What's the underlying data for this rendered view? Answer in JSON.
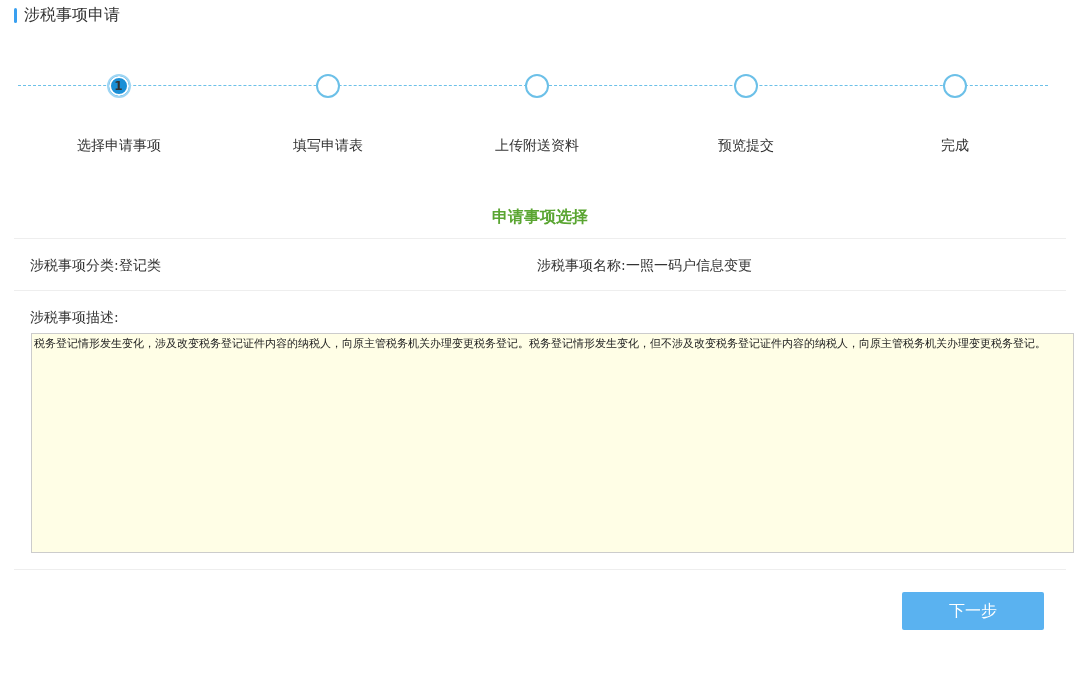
{
  "page_title": "涉税事项申请",
  "steps": [
    {
      "label": "选择申请事项",
      "number": "1",
      "selected": true
    },
    {
      "label": "填写申请表",
      "selected": false
    },
    {
      "label": "上传附送资料",
      "selected": false
    },
    {
      "label": "预览提交",
      "selected": false
    },
    {
      "label": "完成",
      "selected": false
    }
  ],
  "section_title": "申请事项选择",
  "fields": [
    {
      "label": "涉税事项分类:",
      "value": "登记类"
    },
    {
      "label": "涉税事项名称:",
      "value": "一照一码户信息变更"
    }
  ],
  "description": {
    "label": "涉税事项描述:",
    "value": "税务登记情形发生变化，涉及改变税务登记证件内容的纳税人，向原主管税务机关办理变更税务登记。税务登记情形发生变化，但不涉及改变税务登记证件内容的纳税人，向原主管税务机关办理变更税务登记。"
  },
  "buttons": [
    {
      "label": "下一步"
    }
  ]
}
